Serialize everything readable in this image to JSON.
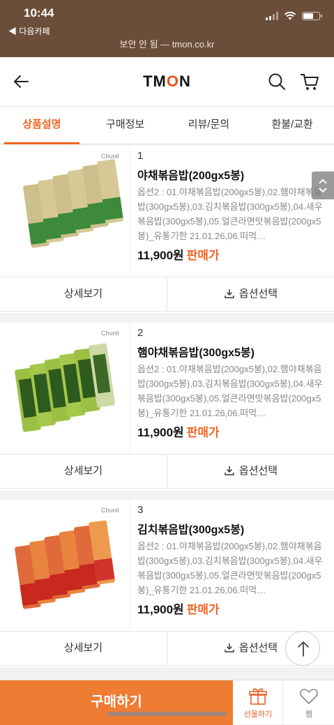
{
  "status_bar": {
    "time": "10:44",
    "back_app": "◀ 다음카페",
    "url": "보안 안 됨 — tmon.co.kr"
  },
  "header": {
    "logo_t": "TM",
    "logo_o": "O",
    "logo_n": "N"
  },
  "tabs": [
    {
      "label": "상품설명",
      "active": true
    },
    {
      "label": "구매정보"
    },
    {
      "label": "리뷰/문의"
    },
    {
      "label": "환불/교환"
    }
  ],
  "colors": {
    "accent": "#f26522",
    "buy_button": "#ee7c32",
    "status_bar": "#6b4e39"
  },
  "products": [
    {
      "number": "1",
      "brand": "Chunil",
      "name": "야채볶음밥(200gx5봉)",
      "description": "옵션2 : 01.야채볶음밥(200gx5봉),02.햄야채볶음밥(300gx5봉),03.김치볶음밥(300gx5봉),04.새우볶음밥(300gx5봉),05.얼큰라면맛볶음밥(200gx5봉)_유통기한 21.01.26,06.떠먹…",
      "price": "11,900원",
      "price_tag": "판매가",
      "detail_label": "상세보기",
      "option_label": "옵션선택"
    },
    {
      "number": "2",
      "brand": "Chunil",
      "name": "햄야채볶음밥(300gx5봉)",
      "description": "옵션2 : 01.야채볶음밥(200gx5봉),02.햄야채볶음밥(300gx5봉),03.김치볶음밥(300gx5봉),04.새우볶음밥(300gx5봉),05.얼큰라면맛볶음밥(200gx5봉)_유통기한 21.01.26,06.떠먹…",
      "price": "11,900원",
      "price_tag": "판매가",
      "detail_label": "상세보기",
      "option_label": "옵션선택"
    },
    {
      "number": "3",
      "brand": "Chunil",
      "name": "김치볶음밥(300gx5봉)",
      "description": "옵션2 : 01.야채볶음밥(200gx5봉),02.햄야채볶음밥(300gx5봉),03.김치볶음밥(300gx5봉),04.새우볶음밥(300gx5봉),05.얼큰라면맛볶음밥(200gx5봉)_유통기한 21.01.26,06.떠먹…",
      "price": "11,900원",
      "price_tag": "판매가",
      "detail_label": "상세보기",
      "option_label": "옵션선택"
    }
  ],
  "bottom_bar": {
    "buy_label": "구매하기",
    "gift_label": "선물하기",
    "wish_label": "찜"
  },
  "icons": [
    "back-arrow-icon",
    "search-icon",
    "cart-icon",
    "download-icon",
    "scroll-chevron-icon",
    "arrow-up-icon",
    "gift-icon",
    "heart-icon"
  ]
}
